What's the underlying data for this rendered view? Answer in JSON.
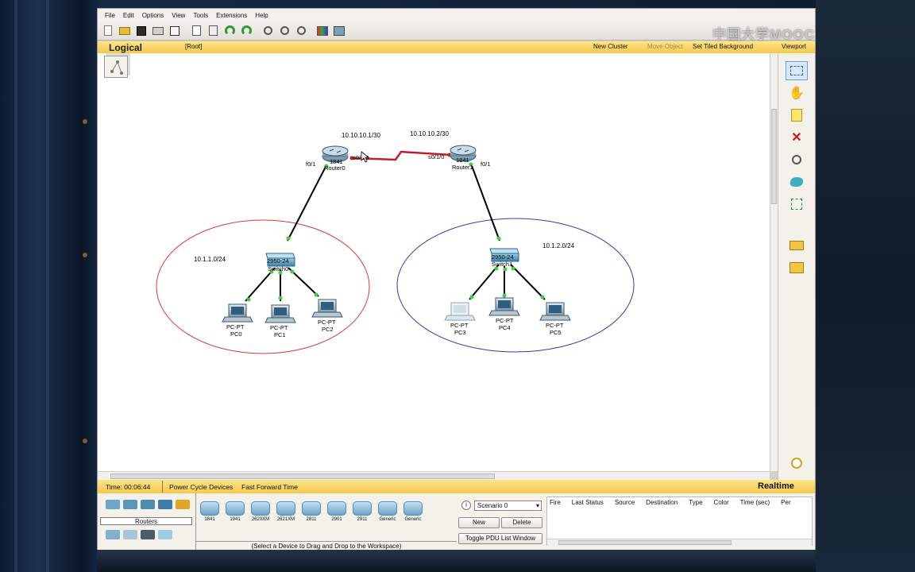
{
  "menu": [
    "File",
    "Edit",
    "Options",
    "View",
    "Tools",
    "Extensions",
    "Help"
  ],
  "watermark": "中国大学MOOC",
  "logical_bar": {
    "title": "Logical",
    "root": "[Root]",
    "new_cluster": "New Cluster",
    "move_object": "Move Object",
    "set_tiled_background": "Set Tiled Background",
    "viewport": "Viewport"
  },
  "topology": {
    "router0": {
      "model": "1841",
      "name": "Router0",
      "link_ip": "10.10.10.1/30",
      "serial": "s0/1/0",
      "fast": "f0/1"
    },
    "router1": {
      "model": "1841",
      "name": "Router1",
      "link_ip": "10.10.10.2/30",
      "serial": "s0/1/0",
      "fast": "f0/1"
    },
    "switch0": {
      "model": "2950-24",
      "name": "Switch0"
    },
    "switch1": {
      "model": "2950-24",
      "name": "Switch1"
    },
    "network0": "10.1.1.0/24",
    "network1": "10.1.2.0/24",
    "pcs": [
      {
        "type": "PC-PT",
        "name": "PC0"
      },
      {
        "type": "PC-PT",
        "name": "PC1"
      },
      {
        "type": "PC-PT",
        "name": "PC2"
      },
      {
        "type": "PC-PT",
        "name": "PC3"
      },
      {
        "type": "PC-PT",
        "name": "PC4"
      },
      {
        "type": "PC-PT",
        "name": "PC5"
      }
    ],
    "colors": {
      "serial_link": "#c0202a",
      "ethernet_link": "#000000",
      "port_up": "#3ad23a",
      "port_serial": "#d01a1a",
      "area0": "#d93a3a",
      "area1": "#3a3aa8"
    }
  },
  "status": {
    "time": "Time: 00:06:44",
    "power_cycle": "Power Cycle Devices",
    "fast_forward": "Fast Forward Time",
    "realtime": "Realtime"
  },
  "device_panel": {
    "category": "Routers",
    "devices": [
      "1841",
      "1941",
      "2620XM",
      "2621XM",
      "2811",
      "2901",
      "2911",
      "Generic",
      "Generic"
    ],
    "hint": "(Select a Device to Drag and Drop to the Workspace)"
  },
  "scenario": {
    "selected": "Scenario 0",
    "new": "New",
    "delete": "Delete",
    "toggle": "Toggle PDU List Window"
  },
  "pdu_columns": [
    "Fire",
    "Last Status",
    "Source",
    "Destination",
    "Type",
    "Color",
    "Time (sec)",
    "Per"
  ]
}
